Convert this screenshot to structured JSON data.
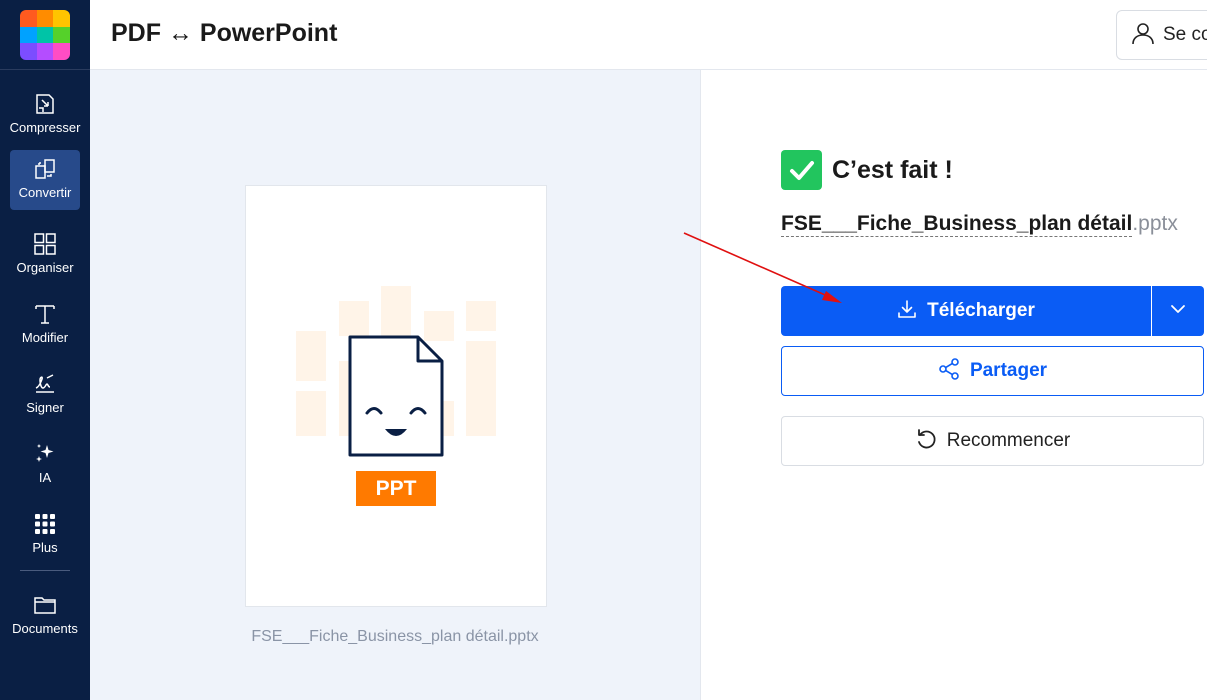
{
  "app": {
    "title": "PDF ↔ PowerPoint",
    "logo_colors": [
      "#ff5a1f",
      "#ff8c00",
      "#ffc400",
      "#00a2ff",
      "#00c4a7",
      "#55d12a",
      "#7c4dff",
      "#b44dff",
      "#ff4dc4"
    ]
  },
  "header": {
    "login_label": "Se co"
  },
  "sidebar": {
    "items": [
      {
        "label": "Compresser",
        "icon": "compress-icon"
      },
      {
        "label": "Convertir",
        "icon": "convert-icon",
        "active": true
      },
      {
        "label": "Organiser",
        "icon": "grid-icon"
      },
      {
        "label": "Modifier",
        "icon": "text-icon"
      },
      {
        "label": "Signer",
        "icon": "signature-icon"
      },
      {
        "label": "IA",
        "icon": "sparkle-icon"
      },
      {
        "label": "Plus",
        "icon": "dots-grid-icon"
      },
      {
        "label": "Documents",
        "icon": "folder-icon"
      }
    ]
  },
  "preview": {
    "badge": "PPT",
    "filename": "FSE___Fiche_Business_plan détail.pptx"
  },
  "result": {
    "done_text": "C’est fait !",
    "file_name": "FSE___Fiche_Business_plan détail",
    "file_ext": ".pptx",
    "download_label": "Télécharger",
    "share_label": "Partager",
    "restart_label": "Recommencer"
  },
  "colors": {
    "sidebar_bg": "#0a1f44",
    "primary": "#0a5cf5",
    "success": "#22c55e",
    "badge": "#ff7a00",
    "annotation_arrow": "#e01010"
  }
}
